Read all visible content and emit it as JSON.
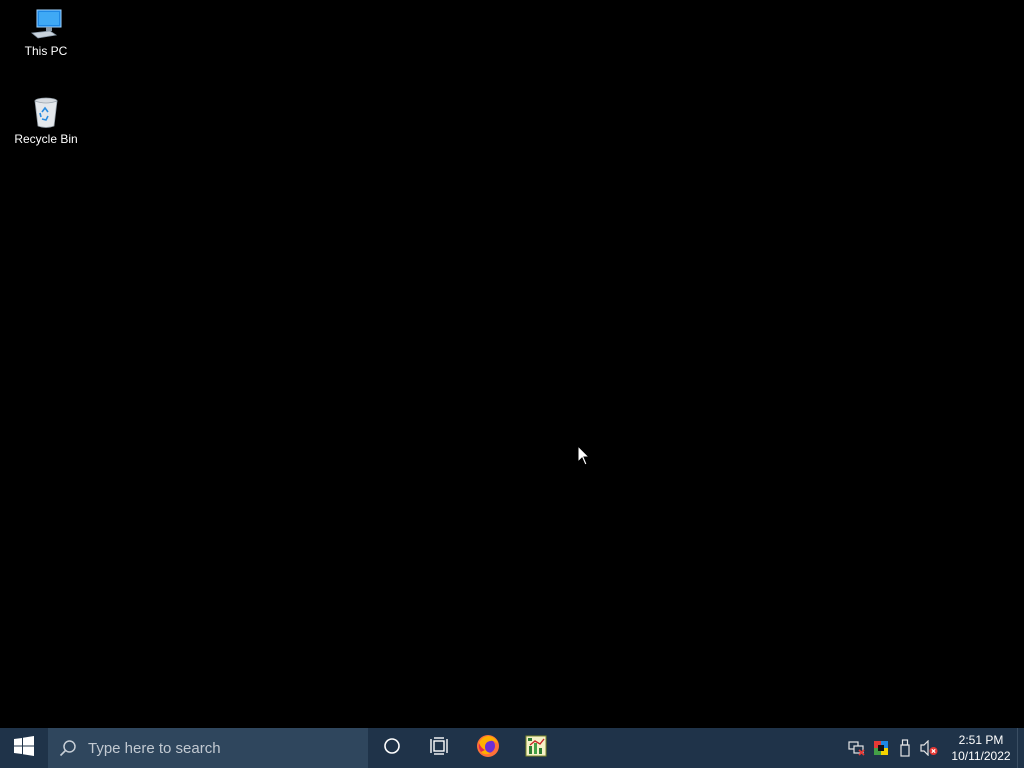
{
  "desktop": {
    "icons": [
      {
        "label": "This PC",
        "icon": "this-pc-icon"
      },
      {
        "label": "Recycle Bin",
        "icon": "recycle-bin-icon"
      }
    ]
  },
  "taskbar": {
    "start_icon": "windows-logo-icon",
    "search": {
      "placeholder": "Type here to search",
      "icon": "search-icon"
    },
    "buttons": [
      {
        "icon": "cortana-icon"
      },
      {
        "icon": "task-view-icon"
      },
      {
        "icon": "firefox-icon"
      },
      {
        "icon": "chart-app-icon"
      }
    ],
    "tray": {
      "icons": [
        "network-disconnected-icon",
        "display-color-icon",
        "usb-device-icon",
        "volume-muted-icon"
      ],
      "time": "2:51 PM",
      "date": "10/11/2022"
    }
  },
  "colors": {
    "desktop_bg": "#000000",
    "taskbar_bg": "#1f3349",
    "search_bg": "#2f465d"
  }
}
